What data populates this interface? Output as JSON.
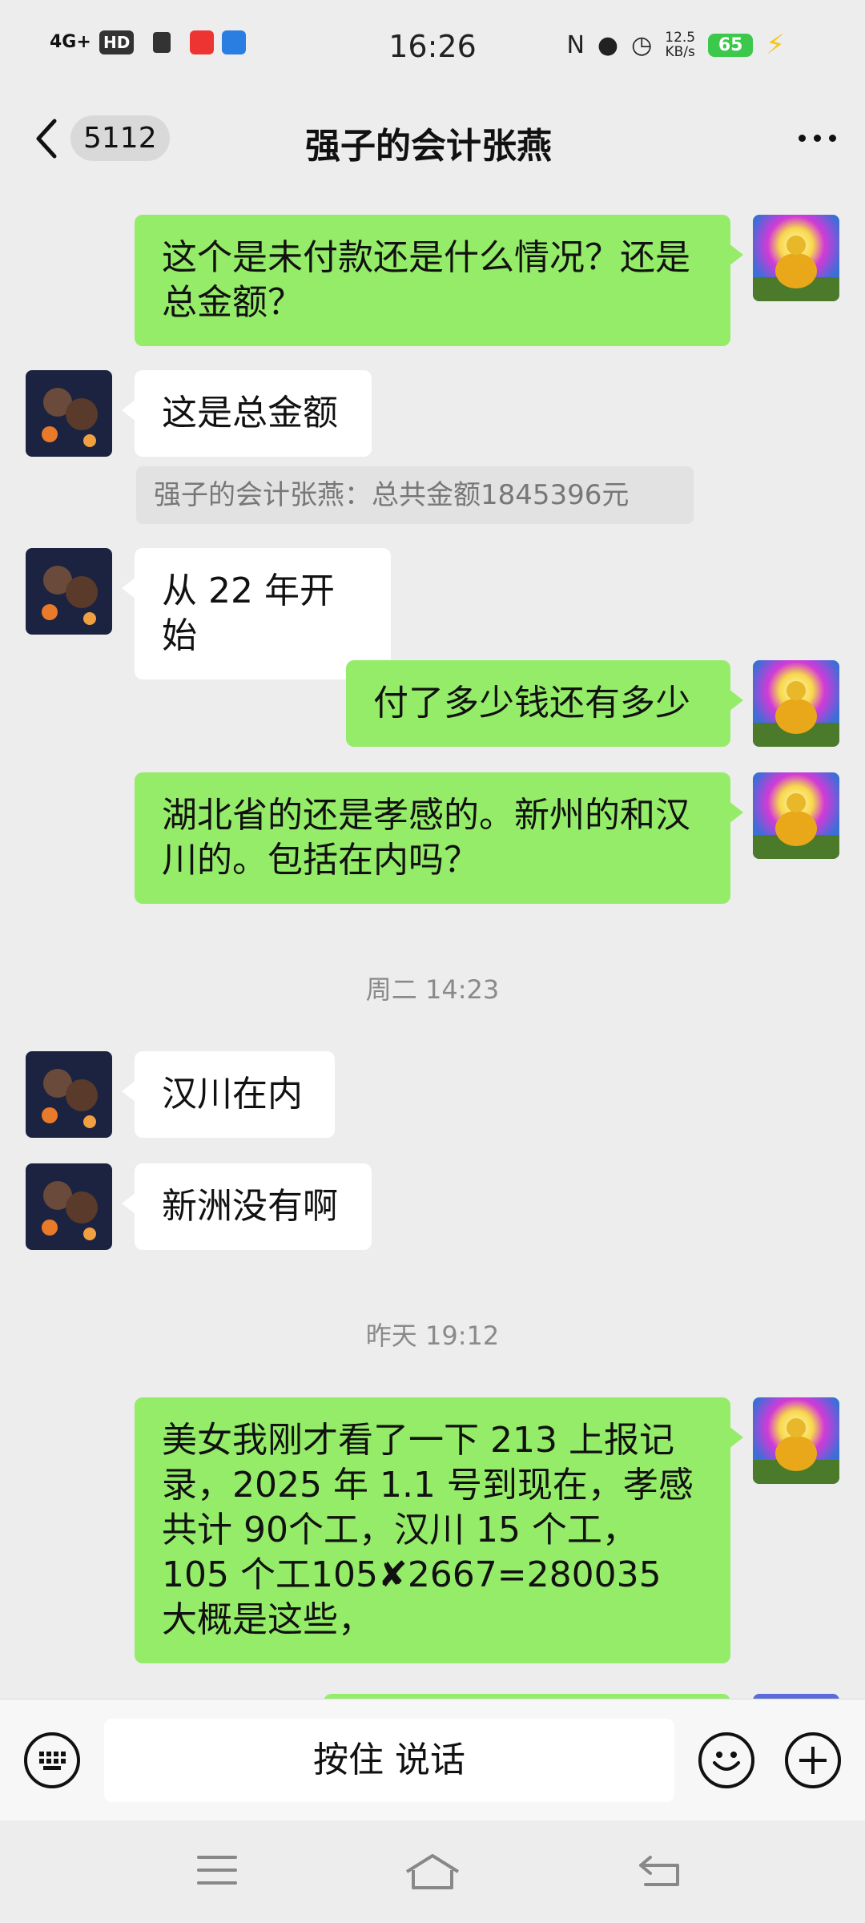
{
  "status_bar": {
    "network": "4G+",
    "hd": "HD",
    "time": "16:26",
    "speed_value": "12.5",
    "speed_unit": "KB/s",
    "battery": "65"
  },
  "header": {
    "unread_count": "5112",
    "title": "强子的会计张燕"
  },
  "messages": {
    "m1": "这个是未付款还是什么情况？还是总金额？",
    "m2": "这是总金额",
    "m2_quote": "强子的会计张燕：总共金额1845396元",
    "m3": "从 22 年开始",
    "m4": "付了多少钱还有多少",
    "m5": "湖北省的还是孝感的。新州的和汉川的。包括在内吗？",
    "ts1": "周二 14:23",
    "m6": "汉川在内",
    "m7": "新洲没有啊",
    "ts2": "昨天 19:12",
    "m8": "美女我刚才看了一下 213 上报记录，2025 年 1.1 号到现在，孝感共计 90个工，汉川 15 个工，105 个工105✘2667=280035 大概是这些，"
  },
  "input": {
    "voice_label": "按住 说话"
  },
  "colors": {
    "my_bubble": "#95ec69",
    "their_bubble": "#ffffff",
    "background": "#ededed"
  },
  "icons": [
    "back-icon",
    "more-icon",
    "keyboard-icon",
    "emoji-icon",
    "plus-icon",
    "menu-icon",
    "home-icon",
    "back-nav-icon"
  ]
}
